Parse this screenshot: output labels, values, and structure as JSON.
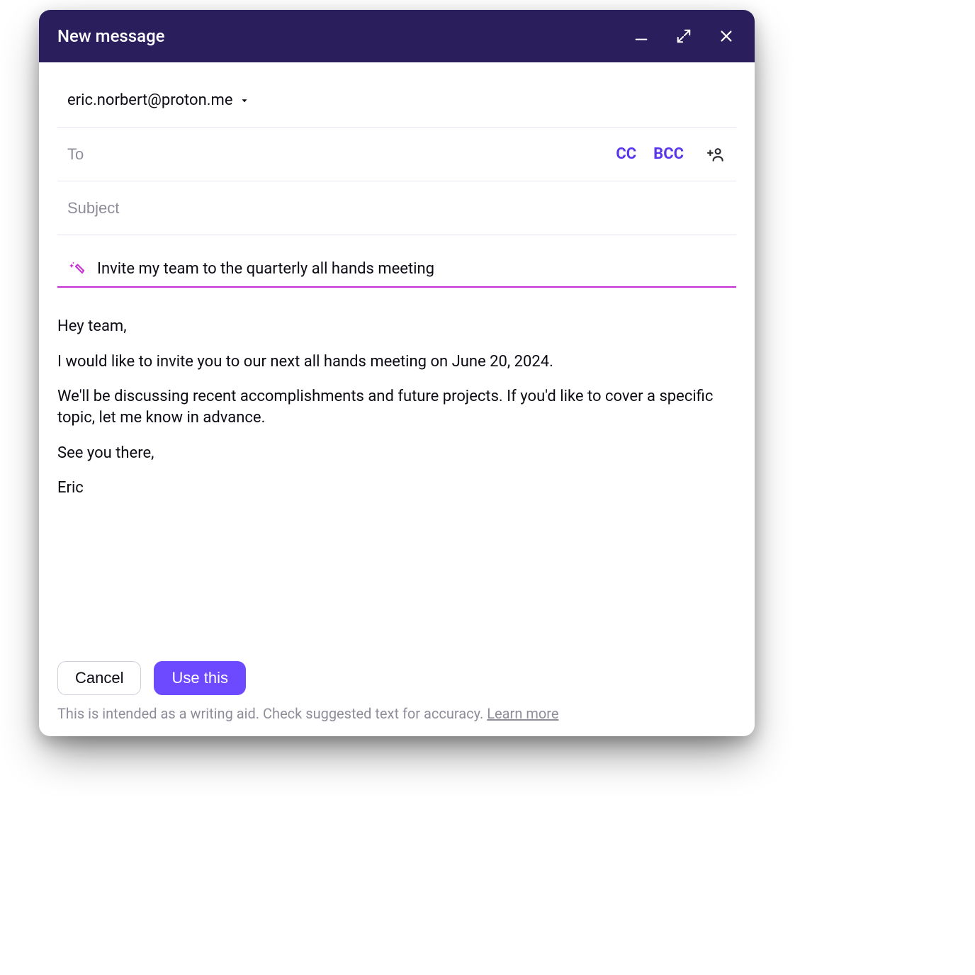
{
  "window": {
    "title": "New message"
  },
  "from": {
    "address": "eric.norbert@proton.me"
  },
  "to": {
    "placeholder": "To",
    "value": "",
    "cc_label": "CC",
    "bcc_label": "BCC"
  },
  "subject": {
    "placeholder": "Subject",
    "value": ""
  },
  "ai": {
    "prompt": "Invite my team to the quarterly all hands meeting"
  },
  "body": {
    "p1": "Hey team,",
    "p2": "I would like to invite you to our next all hands meeting on June 20, 2024.",
    "p3": "We'll be discussing recent accomplishments and future projects. If you'd like to cover a specific topic, let me know in advance.",
    "p4": "See you there,",
    "p5": "Eric"
  },
  "actions": {
    "cancel": "Cancel",
    "use_this": "Use this"
  },
  "disclaimer": {
    "text": "This is intended as a writing aid. Check suggested text for accuracy. ",
    "learn_more": "Learn more"
  },
  "colors": {
    "titlebar": "#2a1e5c",
    "accent": "#6d4aff",
    "magic": "#c72ed6"
  }
}
